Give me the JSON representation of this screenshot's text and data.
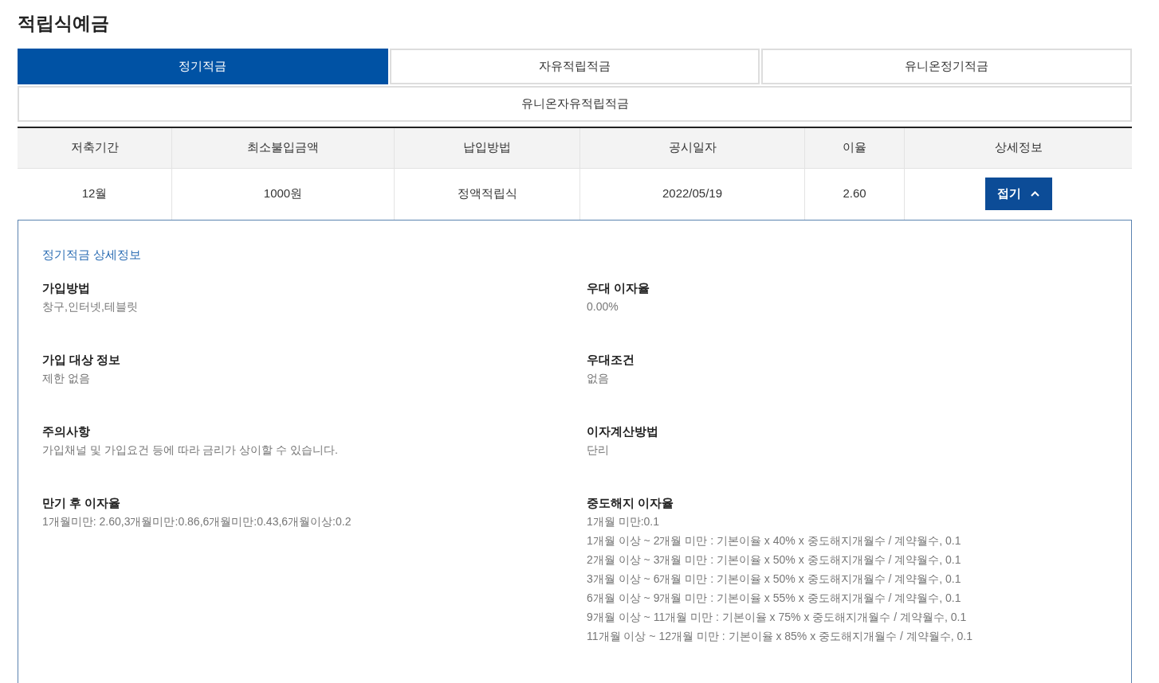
{
  "page_title": "적립식예금",
  "tabs": [
    {
      "label": "정기적금",
      "selected": true
    },
    {
      "label": "자유적립적금",
      "selected": false
    },
    {
      "label": "유니온정기적금",
      "selected": false
    },
    {
      "label": "유니온자유적립적금",
      "selected": false
    }
  ],
  "table": {
    "columns": [
      "저축기간",
      "최소불입금액",
      "납입방법",
      "공시일자",
      "이율",
      "상세정보"
    ],
    "rows": [
      {
        "cells": [
          "12월",
          "1000원",
          "정액적립식",
          "2022/05/19",
          "2.60"
        ],
        "toggle_label": "접기",
        "expanded": true
      }
    ]
  },
  "detail": {
    "title": "정기적금 상세정보",
    "items": [
      {
        "label": "가입방법",
        "lines": [
          "창구,인터넷,테블릿"
        ]
      },
      {
        "label": "우대 이자율",
        "lines": [
          "0.00%"
        ]
      },
      {
        "label": "가입 대상 정보",
        "lines": [
          "제한 없음"
        ]
      },
      {
        "label": "우대조건",
        "lines": [
          "없음"
        ]
      },
      {
        "label": "주의사항",
        "lines": [
          "가입채널 및 가입요건 등에 따라 금리가 상이할 수 있습니다."
        ]
      },
      {
        "label": "이자계산방법",
        "lines": [
          "단리"
        ]
      },
      {
        "label": "만기 후 이자율",
        "lines": [
          "1개월미만: 2.60,3개월미만:0.86,6개월미만:0.43,6개월이상:0.2"
        ]
      },
      {
        "label": "중도해지 이자율",
        "lines": [
          "1개월 미만:0.1",
          "1개월 이상 ~ 2개월 미만 : 기본이율 x 40% x 중도해지개월수 / 계약월수, 0.1",
          "2개월 이상 ~ 3개월 미만 : 기본이율 x 50% x 중도해지개월수 / 계약월수, 0.1",
          "3개월 이상 ~ 6개월 미만 : 기본이율 x 50% x 중도해지개월수 / 계약월수, 0.1",
          "6개월 이상 ~ 9개월 미만 : 기본이율 x 55% x 중도해지개월수 / 계약월수, 0.1",
          "9개월 이상 ~ 11개월 미만 : 기본이율 x 75% x 중도해지개월수 / 계약월수, 0.1",
          "11개월 이상 ~ 12개월 미만 : 기본이율 x 85% x 중도해지개월수 / 계약월수, 0.1"
        ]
      }
    ]
  }
}
